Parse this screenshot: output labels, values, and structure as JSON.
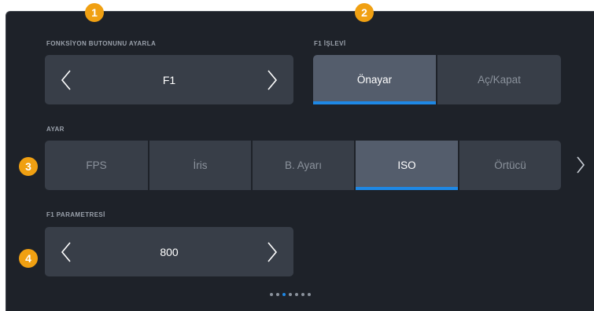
{
  "callouts": [
    "1",
    "2",
    "3",
    "4"
  ],
  "function_button": {
    "label": "FONKSİYON BUTONUNU AYARLA",
    "value": "F1"
  },
  "f1_function": {
    "label": "F1 İŞLEVİ",
    "options": [
      "Önayar",
      "Aç/Kapat"
    ],
    "selected": "Önayar"
  },
  "setting": {
    "label": "AYAR",
    "options": [
      "FPS",
      "İris",
      "B. Ayarı",
      "ISO",
      "Örtücü"
    ],
    "selected": "ISO"
  },
  "f1_parameter": {
    "label": "F1 PARAMETRESİ",
    "value": "800"
  },
  "pagination": {
    "pages": 7,
    "current": 3
  },
  "colors": {
    "background": "#1e2229",
    "button": "#383e48",
    "active_button": "#545d6c",
    "accent": "#1e88e5",
    "callout": "#f0a012"
  }
}
